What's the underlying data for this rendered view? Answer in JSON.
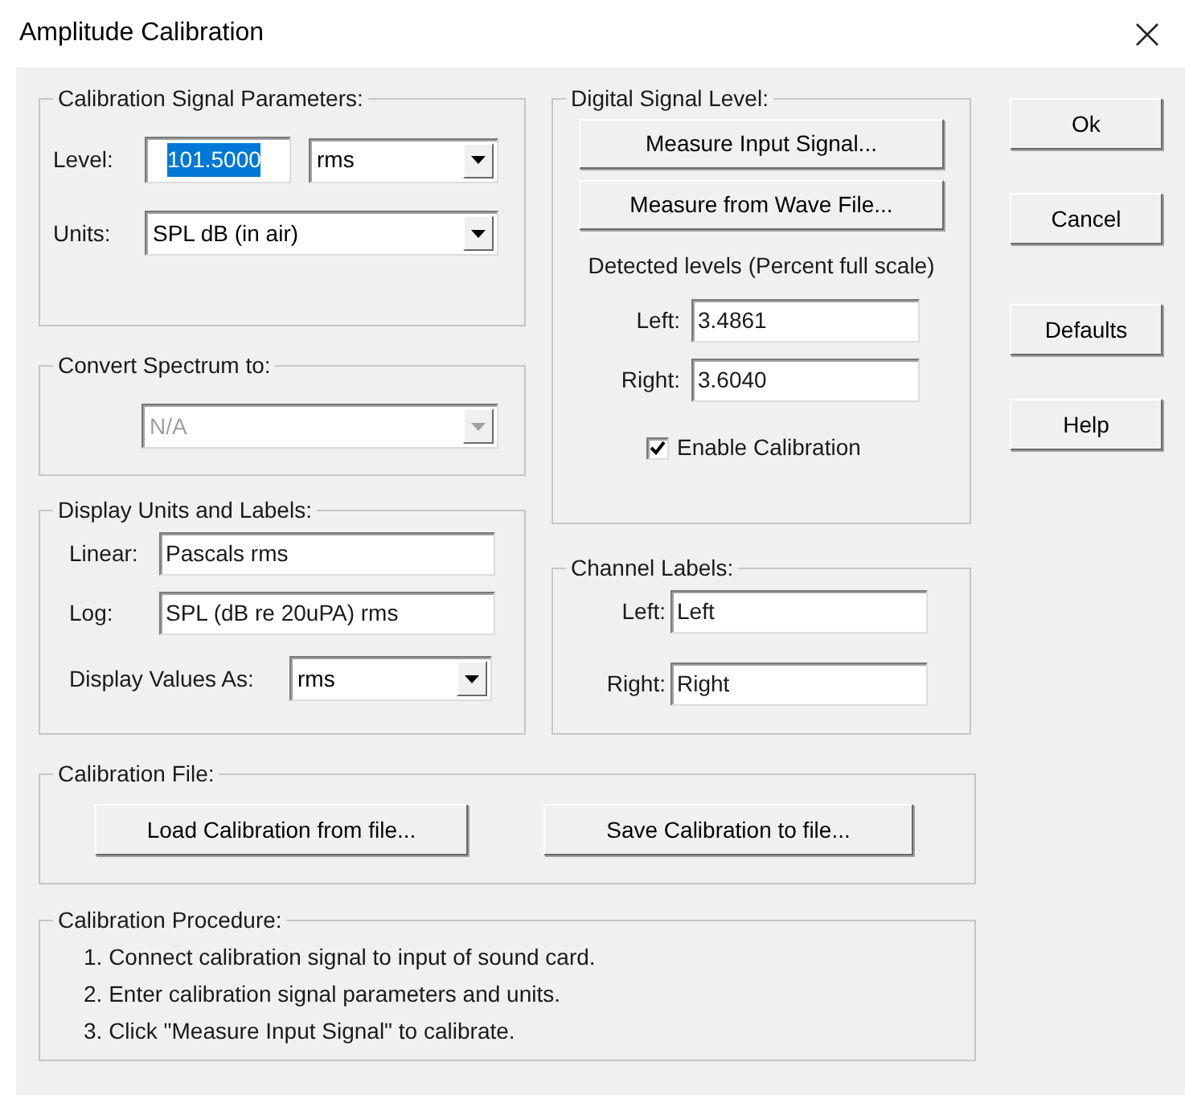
{
  "window": {
    "title": "Amplitude Calibration"
  },
  "calibration_signal_parameters": {
    "title": "Calibration Signal Parameters:",
    "level": {
      "label": "Level:",
      "value": "101.5000",
      "text_selected": true
    },
    "level_type": {
      "value": "rms"
    },
    "units": {
      "label": "Units:",
      "value": "SPL dB (in air)"
    }
  },
  "convert_spectrum": {
    "title": "Convert Spectrum to:",
    "value": "N/A",
    "disabled": true
  },
  "display_units": {
    "title": "Display Units and Labels:",
    "linear": {
      "label": "Linear:",
      "value": "Pascals rms"
    },
    "log": {
      "label": "Log:",
      "value": "SPL (dB re 20uPA) rms"
    },
    "display_values_as": {
      "label": "Display Values As:",
      "value": "rms"
    }
  },
  "digital_signal_level": {
    "title": "Digital Signal Level:",
    "buttons": [
      "Measure Input Signal...",
      "Measure from Wave File..."
    ],
    "caption": "Detected levels (Percent full scale)",
    "left": {
      "label": "Left:",
      "value": "3.4861"
    },
    "right": {
      "label": "Right:",
      "value": "3.6040"
    },
    "enable_calibration": {
      "label": "Enable Calibration",
      "checked": true
    }
  },
  "channel_labels": {
    "title": "Channel Labels:",
    "left": {
      "label": "Left:",
      "value": "Left"
    },
    "right": {
      "label": "Right:",
      "value": "Right"
    }
  },
  "calibration_file": {
    "title": "Calibration File:",
    "buttons": [
      "Load Calibration from file...",
      "Save Calibration to file..."
    ]
  },
  "calibration_procedure": {
    "title": "Calibration Procedure:",
    "steps": [
      "1. Connect calibration signal to input of sound card.",
      "2. Enter calibration signal parameters and units.",
      "3. Click \"Measure Input Signal\" to calibrate."
    ]
  },
  "dialog_buttons": [
    "Ok",
    "Cancel",
    "Defaults",
    "Help"
  ]
}
